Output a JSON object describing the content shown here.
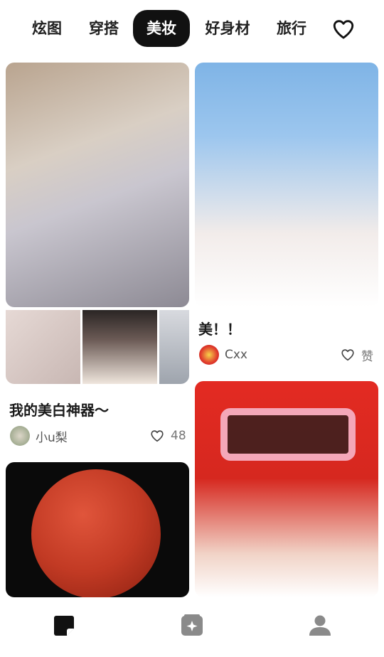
{
  "tabs": [
    {
      "label": "炫图"
    },
    {
      "label": "穿搭"
    },
    {
      "label": "美妆",
      "active": true
    },
    {
      "label": "好身材"
    },
    {
      "label": "旅行"
    }
  ],
  "favorites_icon": "heart-outline-icon",
  "cards": [
    {
      "title": "我的美白神器～",
      "author": "小u梨",
      "likes": "48"
    },
    {
      "title": "美！！",
      "author": "Cxx",
      "likes": "赞"
    }
  ],
  "bottom_nav": [
    "note-icon",
    "compass-card-icon",
    "person-icon"
  ],
  "colors": {
    "active_tab_bg": "#111111",
    "icon_dark": "#111111",
    "icon_gray": "#888888"
  }
}
